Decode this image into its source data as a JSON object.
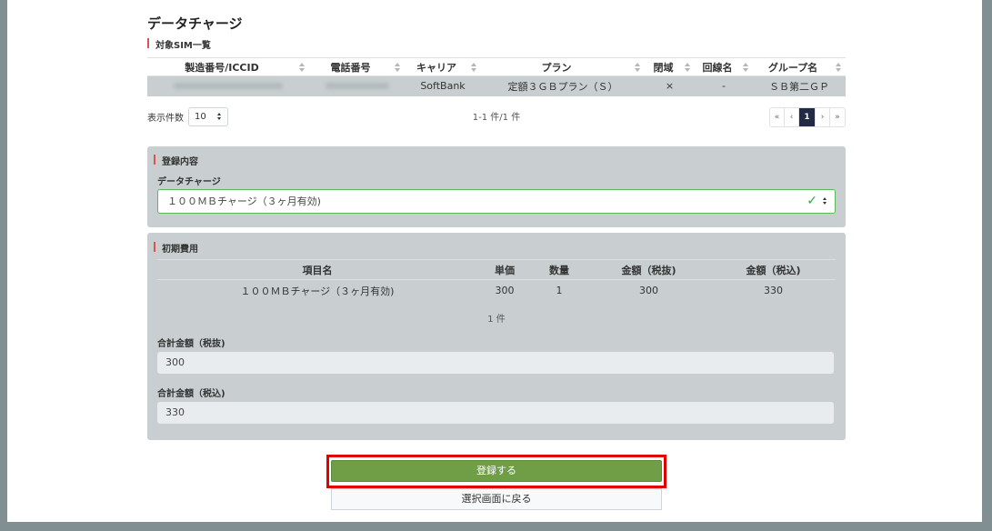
{
  "page_title": "データチャージ",
  "sim_list": {
    "label": "対象SIM一覧",
    "columns": [
      "製造番号/ICCID",
      "電話番号",
      "キャリア",
      "プラン",
      "閉域",
      "回線名",
      "グループ名"
    ],
    "rows": [
      {
        "iccid": "",
        "phone": "",
        "carrier": "SoftBank",
        "plan": "定額３ＧＢプラン（Ｓ）",
        "closed": "×",
        "line_name": "-",
        "group": "ＳＢ第二ＧＰ"
      }
    ],
    "per_page_label": "表示件数",
    "per_page_value": "10",
    "count_text": "1-1 件/1 件",
    "pager": [
      "«",
      "‹",
      "1",
      "›",
      "»"
    ]
  },
  "registration": {
    "section_label": "登録内容",
    "field_label": "データチャージ",
    "selected_value": "１００ＭＢチャージ（３ヶ月有効)"
  },
  "initial_fee": {
    "section_label": "初期費用",
    "columns": [
      "項目名",
      "単価",
      "数量",
      "金額（税抜)",
      "金額（税込)"
    ],
    "rows": [
      {
        "item": "１００ＭＢチャージ（３ヶ月有効)",
        "unit_price": "300",
        "qty": "1",
        "amount_ex": "300",
        "amount_in": "330"
      }
    ],
    "count_text": "1 件",
    "total_ex_label": "合計金額（税抜)",
    "total_ex_value": "300",
    "total_in_label": "合計金額（税込)",
    "total_in_value": "330"
  },
  "buttons": {
    "register": "登録する",
    "back": "選択画面に戻る"
  },
  "colors": {
    "accent_bar": "#d9534f",
    "primary_button": "#6f9e47",
    "highlight_frame": "#e00000",
    "active_page": "#222a45"
  }
}
